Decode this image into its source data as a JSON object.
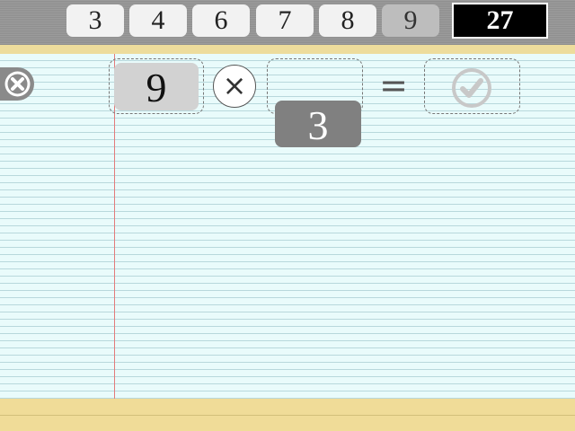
{
  "tiles": [
    {
      "label": "3",
      "used": false
    },
    {
      "label": "4",
      "used": false
    },
    {
      "label": "6",
      "used": false
    },
    {
      "label": "7",
      "used": false
    },
    {
      "label": "8",
      "used": false
    },
    {
      "label": "9",
      "used": true
    }
  ],
  "target": "27",
  "equation": {
    "operand1": "9",
    "operator": "×",
    "operand2": "",
    "equals": "=",
    "result_icon": "check-icon"
  },
  "dragged_tile": "3",
  "icons": {
    "close": "close-icon",
    "check": "check-icon"
  },
  "colors": {
    "paper": "#e9fbfb",
    "paper_lines": "#b8d8dc",
    "margin_line": "#e37b7b",
    "strip": "#f0dc98",
    "target_bg": "#000000"
  }
}
